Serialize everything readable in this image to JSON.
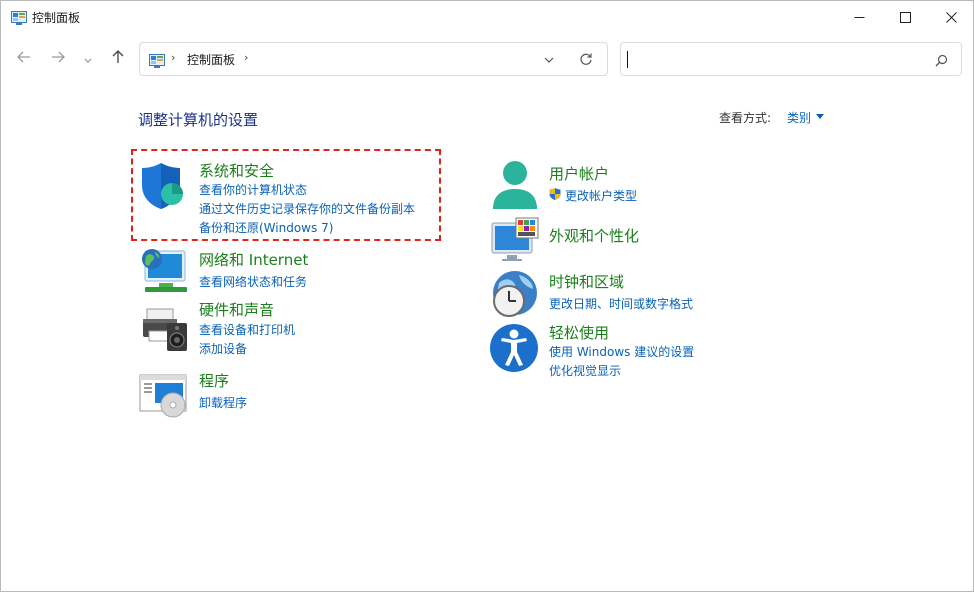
{
  "window": {
    "title": "控制面板"
  },
  "address_bar": {
    "separator": "›",
    "crumb": "控制面板"
  },
  "search": {
    "value": "",
    "placeholder": ""
  },
  "content": {
    "page_title": "调整计算机的设置",
    "view_by_label": "查看方式:",
    "view_by_value": "类别"
  },
  "categories": {
    "system_security": {
      "title": "系统和安全",
      "links": [
        "查看你的计算机状态",
        "通过文件历史记录保存你的文件备份副本",
        "备份和还原(Windows 7)"
      ]
    },
    "network_internet": {
      "title": "网络和 Internet",
      "links": [
        "查看网络状态和任务"
      ]
    },
    "hardware_sound": {
      "title": "硬件和声音",
      "links": [
        "查看设备和打印机",
        "添加设备"
      ]
    },
    "programs": {
      "title": "程序",
      "links": [
        "卸载程序"
      ]
    },
    "user_accounts": {
      "title": "用户帐户",
      "links": [
        "更改帐户类型"
      ]
    },
    "appearance": {
      "title": "外观和个性化",
      "links": []
    },
    "clock_region": {
      "title": "时钟和区域",
      "links": [
        "更改日期、时间或数字格式"
      ]
    },
    "ease_of_access": {
      "title": "轻松使用",
      "links": [
        "使用 Windows 建议的设置",
        "优化视觉显示"
      ]
    }
  },
  "colors": {
    "category_title": "#1a7f1a",
    "link": "#0a62b6",
    "page_title": "#1e3287",
    "highlight_border": "#e0241b"
  },
  "icons": {
    "window": "control-panel-icon",
    "system_security": "shield-icon",
    "network_internet": "network-globe-icon",
    "hardware_sound": "printer-speaker-icon",
    "programs": "programs-disc-icon",
    "user_accounts": "user-icon",
    "appearance": "monitor-palette-icon",
    "clock_region": "clock-globe-icon",
    "ease_of_access": "accessibility-icon"
  }
}
